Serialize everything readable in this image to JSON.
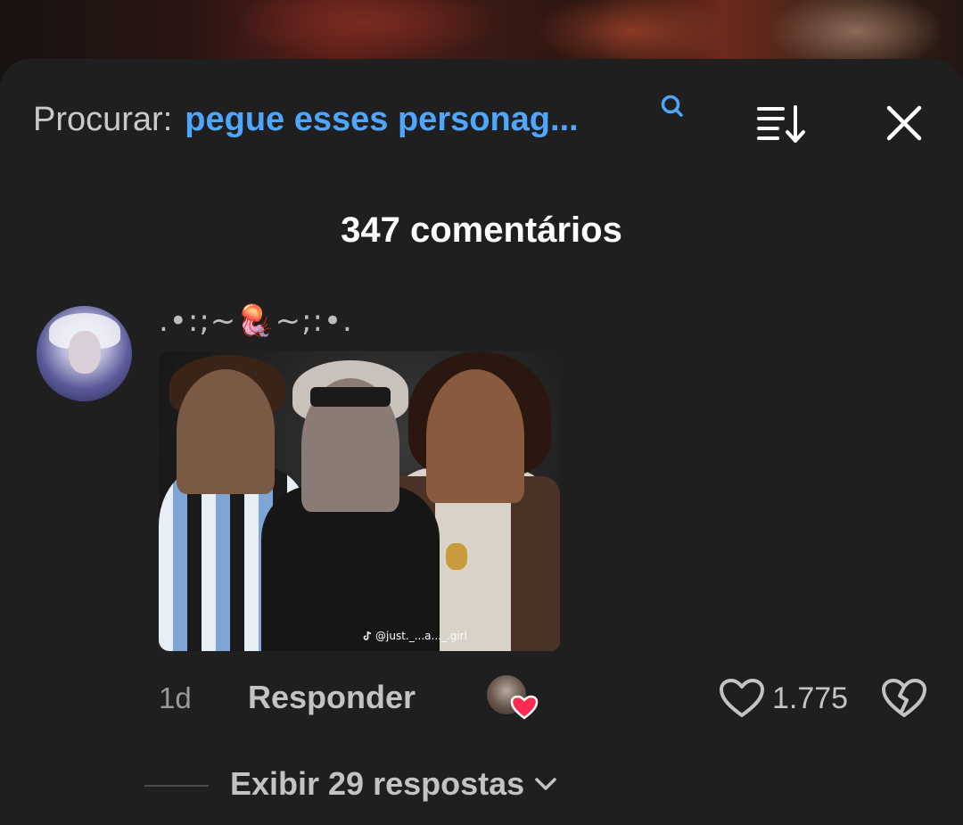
{
  "header": {
    "search_label": "Procurar:",
    "search_query": "pegue esses personag...",
    "icons": {
      "search": "search-icon",
      "sort": "sort-icon",
      "close": "close-icon"
    }
  },
  "comments_count_title": "347 comentários",
  "comment": {
    "username": ".•:;~🪼~;:•.",
    "image_watermark": "@just._...a..._.girl",
    "time": "1d",
    "reply_label": "Responder",
    "likes": "1.775",
    "view_replies_label": "Exibir 29 respostas"
  },
  "colors": {
    "background": "#1f1f1f",
    "accent_link": "#4ea6ff",
    "text_primary": "#ffffff",
    "text_secondary": "#c3c3c3",
    "heart_red": "#fe2c55"
  }
}
